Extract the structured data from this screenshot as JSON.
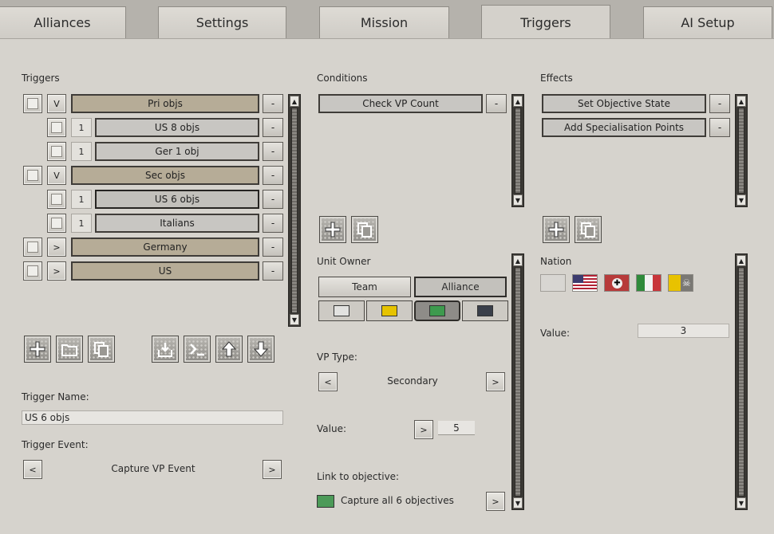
{
  "tabs": [
    {
      "label": "Alliances"
    },
    {
      "label": "Settings"
    },
    {
      "label": "Mission"
    },
    {
      "label": "Triggers"
    },
    {
      "label": "AI Setup"
    }
  ],
  "active_tab": "Triggers",
  "triggers": {
    "heading": "Triggers",
    "rows": [
      {
        "toggle": "V",
        "label": "Pri objs",
        "kind": "group"
      },
      {
        "num": "1",
        "label": "US 8 objs",
        "kind": "item"
      },
      {
        "num": "1",
        "label": "Ger 1 obj",
        "kind": "item"
      },
      {
        "toggle": "V",
        "label": "Sec objs",
        "kind": "group"
      },
      {
        "num": "1",
        "label": "US 6 objs",
        "kind": "item",
        "selected": true
      },
      {
        "num": "1",
        "label": "Italians",
        "kind": "item"
      },
      {
        "toggle": ">",
        "label": "Germany",
        "kind": "group"
      },
      {
        "toggle": ">",
        "label": "US",
        "kind": "group"
      }
    ],
    "remove_label": "-",
    "name_label": "Trigger Name:",
    "name_value": "US 6 objs",
    "event_label": "Trigger Event:",
    "event_value": "Capture VP Event",
    "prev_label": "<",
    "next_label": ">"
  },
  "conditions": {
    "heading": "Conditions",
    "items": [
      {
        "label": "Check VP Count"
      }
    ],
    "remove_label": "-",
    "unit_owner_label": "Unit Owner",
    "owner_team": "Team",
    "owner_alliance": "Alliance",
    "colors": [
      "#e2e2e0",
      "#e6c300",
      "#3d9a4e",
      "#3a3f4a"
    ],
    "vp_type_label": "VP Type:",
    "vp_type_value": "Secondary",
    "value_label": "Value:",
    "value": "5",
    "link_label": "Link to objective:",
    "link_value": "Capture all 6 objectives",
    "link_color": "#4c9a58",
    "prev_label": "<",
    "next_label": ">"
  },
  "effects": {
    "heading": "Effects",
    "items": [
      {
        "label": "Set Objective State"
      },
      {
        "label": "Add Specialisation Points"
      }
    ],
    "remove_label": "-",
    "nation_label": "Nation",
    "value_label": "Value:",
    "value": "3"
  }
}
